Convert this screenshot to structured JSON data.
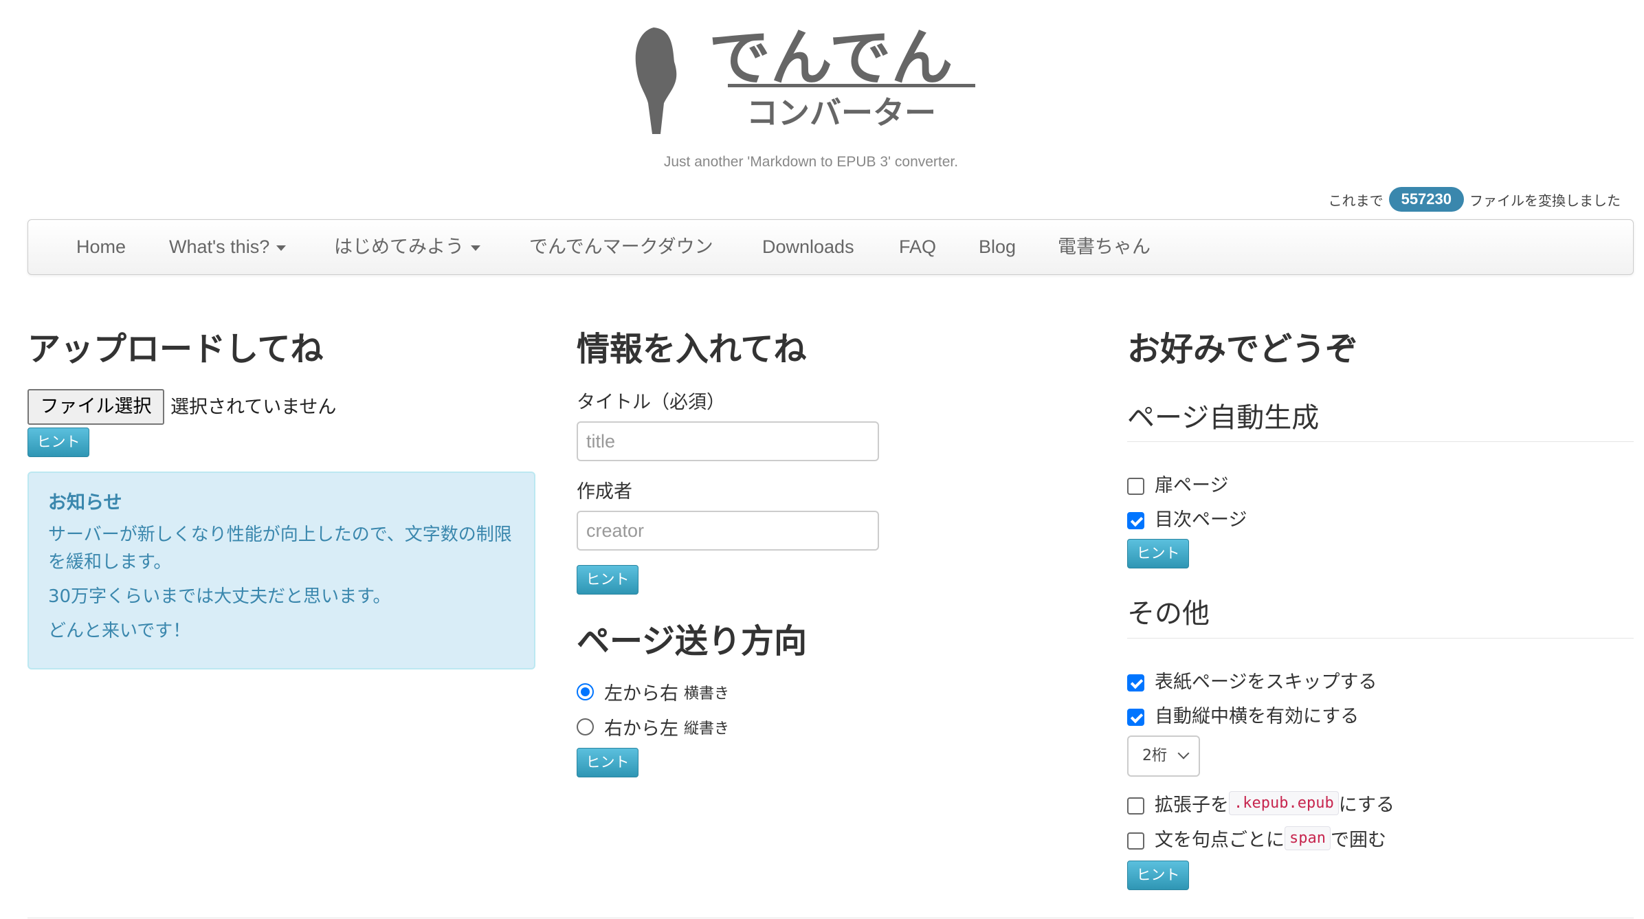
{
  "header": {
    "logo_text": "でんでんコンバーター",
    "tagline": "Just another 'Markdown to EPUB 3' converter.",
    "counter_prefix": "これまで",
    "counter_value": "557230",
    "counter_suffix": "ファイルを変換しました",
    "badge_color": "#3a87ad"
  },
  "nav": {
    "items": [
      {
        "label": "Home"
      },
      {
        "label": "What's this?",
        "dropdown": true
      },
      {
        "label": "はじめてみよう",
        "dropdown": true
      },
      {
        "label": "でんでんマークダウン"
      },
      {
        "label": "Downloads"
      },
      {
        "label": "FAQ"
      },
      {
        "label": "Blog"
      },
      {
        "label": "電書ちゃん"
      }
    ]
  },
  "upload": {
    "heading": "アップロードしてね",
    "file_button": "ファイル選択",
    "file_status": "選択されていません",
    "hint": "ヒント",
    "notice_title": "お知らせ",
    "notice_lines": [
      "サーバーが新しくなり性能が向上したので、文字数の制限を緩和します。",
      "30万字くらいまでは大丈夫だと思います。",
      "どんと来いです！"
    ]
  },
  "info": {
    "heading": "情報を入れてね",
    "title_label": "タイトル（必須）",
    "title_placeholder": "title",
    "creator_label": "作成者",
    "creator_placeholder": "creator",
    "hint": "ヒント",
    "direction_heading": "ページ送り方向",
    "ltr_label": "左から右",
    "ltr_sub": "横書き",
    "rtl_label": "右から左",
    "rtl_sub": "縦書き",
    "ltr_selected": true,
    "hint2": "ヒント"
  },
  "prefs": {
    "heading": "お好みでどうぞ",
    "autogen_heading": "ページ自動生成",
    "title_page": {
      "label": "扉ページ",
      "checked": false
    },
    "toc_page": {
      "label": "目次ページ",
      "checked": true
    },
    "hint": "ヒント",
    "other_heading": "その他",
    "skip_cover": {
      "label": "表紙ページをスキップする",
      "checked": true
    },
    "tcy": {
      "label": "自動縦中横を有効にする",
      "checked": true
    },
    "tcy_digits": "2桁",
    "kepub": {
      "pre": "拡張子を",
      "code": ".kepub.epub",
      "post": "にする",
      "checked": false
    },
    "span": {
      "pre": "文を句点ごとに",
      "code": "span",
      "post": "で囲む",
      "checked": false
    },
    "hint2": "ヒント"
  }
}
